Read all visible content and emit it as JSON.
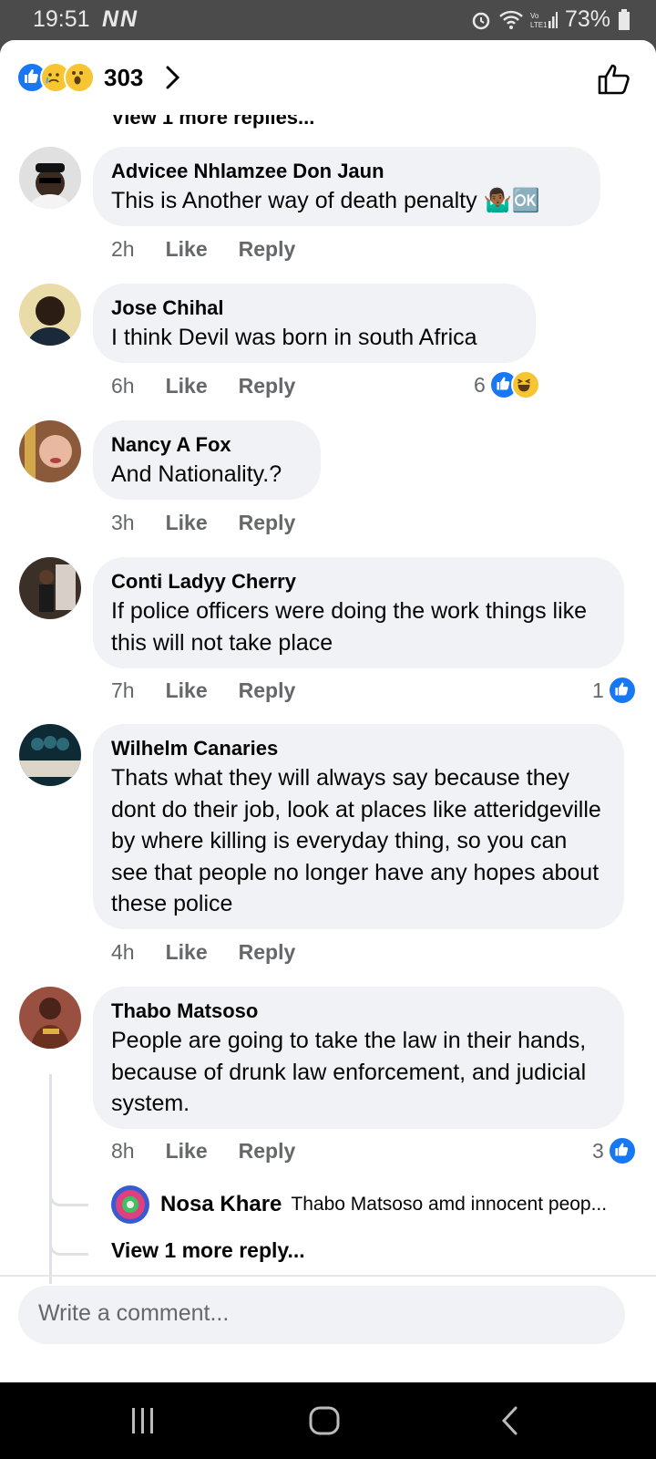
{
  "status_bar": {
    "time": "19:51",
    "left_icons": "NN",
    "battery": "73%"
  },
  "header": {
    "reaction_count": "303",
    "reaction_icons": [
      "like-icon",
      "sad-icon",
      "wow-icon"
    ]
  },
  "cut_text": "View 1 more replies...",
  "comments": [
    {
      "name": "Advicee Nhlamzee Don Jaun",
      "text": "This is Another way of death penalty 🤷🏾‍♂️🆗",
      "time": "2h",
      "like": "Like",
      "reply": "Reply"
    },
    {
      "name": "Jose Chihal",
      "text": "I think Devil was born in south Africa",
      "time": "6h",
      "like": "Like",
      "reply": "Reply",
      "reaction_count": "6"
    },
    {
      "name": "Nancy A Fox",
      "text": "And Nationality.?",
      "time": "3h",
      "like": "Like",
      "reply": "Reply"
    },
    {
      "name": "Conti Ladyy Cherry",
      "text": "If police officers were doing the work things like this will not take place",
      "time": "7h",
      "like": "Like",
      "reply": "Reply",
      "reaction_count": "1"
    },
    {
      "name": "Wilhelm Canaries",
      "text": "Thats what they will always say because they dont do their job, look at places like atteridgeville by where killing is everyday thing, so you can see that people no longer have any hopes about these police",
      "time": "4h",
      "like": "Like",
      "reply": "Reply"
    },
    {
      "name": "Thabo Matsoso",
      "text": "People are going to take the law in their hands, because of drunk law enforcement, and judicial system.",
      "time": "8h",
      "like": "Like",
      "reply": "Reply",
      "reaction_count": "3"
    }
  ],
  "reply_preview": {
    "name": "Nosa Khare",
    "text": "Thabo Matsoso amd innocent peop..."
  },
  "view_more": "View 1 more reply...",
  "composer": {
    "placeholder": "Write a comment..."
  },
  "colors": {
    "like_blue": "#1877f2",
    "bubble_gray": "#f0f2f5",
    "meta_gray": "#65676b"
  }
}
